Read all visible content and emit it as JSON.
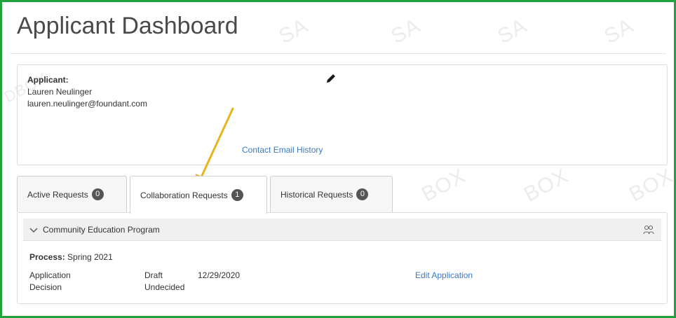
{
  "page": {
    "title": "Applicant Dashboard",
    "accent": "#1fa33a",
    "link_color": "#3a79c4"
  },
  "watermarks": {
    "text_top": "SA",
    "text_bottom": "BOX",
    "text_left": "DBOX"
  },
  "applicant": {
    "label": "Applicant:",
    "name": "Lauren Neulinger",
    "email": "lauren.neulinger@foundant.com",
    "edit_icon": "pencil-icon",
    "contact_link": "Contact Email History"
  },
  "tabs": [
    {
      "label": "Active Requests",
      "count": "0",
      "active": false
    },
    {
      "label": "Collaboration Requests",
      "count": "1",
      "active": true
    },
    {
      "label": "Historical Requests",
      "count": "0",
      "active": false
    }
  ],
  "program": {
    "name": "Community Education Program",
    "collapse_icon": "chevron-down-icon",
    "collaborators_icon": "people-icon",
    "process_label": "Process:",
    "process_value": "Spring 2021",
    "rows": [
      {
        "name": "Application",
        "status": "Draft",
        "date": "12/29/2020",
        "link": "Edit Application"
      },
      {
        "name": "Decision",
        "status": "Undecided",
        "date": "",
        "link": ""
      }
    ]
  },
  "annotation": {
    "arrow_color": "#e8b41c"
  }
}
